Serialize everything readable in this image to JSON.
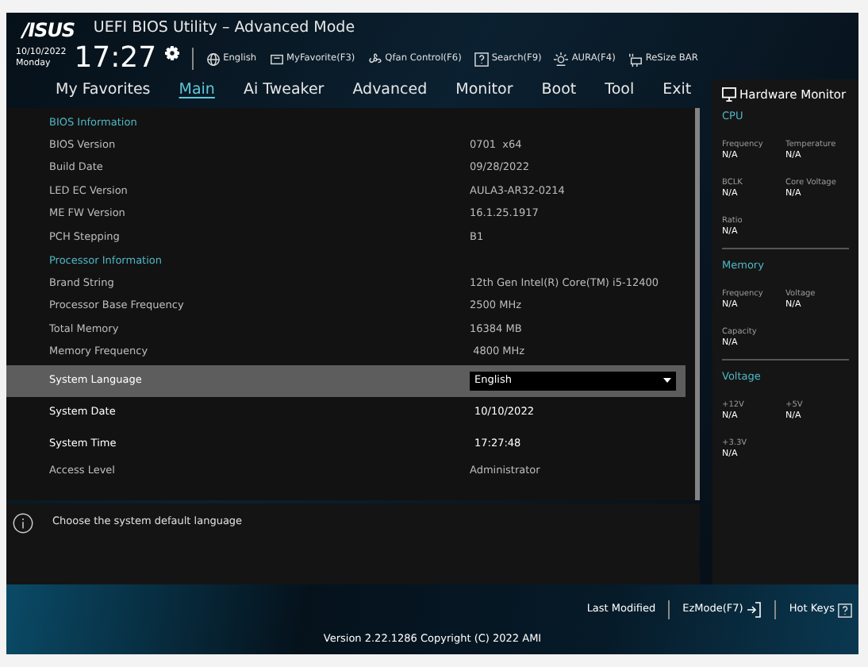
{
  "header": {
    "brand": "/ISUS",
    "title": "UEFI BIOS Utility – Advanced Mode",
    "date": "10/10/2022",
    "day": "Monday",
    "time": "17:27",
    "tools": [
      {
        "kind": "globe",
        "label": "English"
      },
      {
        "kind": "star",
        "label": "MyFavorite(F3)"
      },
      {
        "kind": "fan",
        "label": "Qfan Control(F6)"
      },
      {
        "kind": "help",
        "label": "Search(F9)"
      },
      {
        "kind": "light",
        "label": "AURA(F4)"
      },
      {
        "kind": "bar",
        "label": "ReSize BAR"
      }
    ]
  },
  "tabs": [
    {
      "label": "My Favorites",
      "selected": false
    },
    {
      "label": "Main",
      "selected": true
    },
    {
      "label": "Ai Tweaker",
      "selected": false
    },
    {
      "label": "Advanced",
      "selected": false
    },
    {
      "label": "Monitor",
      "selected": false
    },
    {
      "label": "Boot",
      "selected": false
    },
    {
      "label": "Tool",
      "selected": false
    },
    {
      "label": "Exit",
      "selected": false
    }
  ],
  "rows": [
    {
      "kind": "section",
      "label": "BIOS Information"
    },
    {
      "kind": "info",
      "label": "BIOS Version",
      "value": "0701  x64"
    },
    {
      "kind": "info",
      "label": "Build Date",
      "value": "09/28/2022"
    },
    {
      "kind": "info",
      "label": "LED EC Version",
      "value": "AULA3-AR32-0214"
    },
    {
      "kind": "info",
      "label": "ME FW Version",
      "value": "16.1.25.1917"
    },
    {
      "kind": "info",
      "label": "PCH Stepping",
      "value": "B1"
    },
    {
      "kind": "section",
      "label": "Processor Information"
    },
    {
      "kind": "info",
      "label": "Brand String",
      "value": "12th Gen Intel(R) Core(TM) i5-12400"
    },
    {
      "kind": "info",
      "label": "Processor Base Frequency",
      "value": "2500 MHz"
    },
    {
      "kind": "info",
      "label": "Total Memory",
      "value": "16384 MB"
    },
    {
      "kind": "info",
      "label": "Memory Frequency",
      "value": " 4800 MHz"
    },
    {
      "kind": "dropdown",
      "label": "System Language",
      "value": "English",
      "selected": true
    },
    {
      "kind": "setting",
      "label": "System Date",
      "value": "10/10/2022",
      "selected": false
    },
    {
      "kind": "setting",
      "label": "System Time",
      "value": "17:27:48",
      "selected": false
    },
    {
      "kind": "info",
      "label": "Access Level",
      "value": "Administrator"
    }
  ],
  "help": "Choose the system default language",
  "hardware_monitor": {
    "title": "Hardware Monitor",
    "sections": [
      {
        "title": "CPU",
        "items": [
          {
            "label": "Frequency",
            "value": "N/A"
          },
          {
            "label": "Temperature",
            "value": "N/A"
          },
          {
            "label": "BCLK",
            "value": "N/A"
          },
          {
            "label": "Core Voltage",
            "value": "N/A"
          },
          {
            "label": "Ratio",
            "value": "N/A"
          }
        ]
      },
      {
        "title": "Memory",
        "items": [
          {
            "label": "Frequency",
            "value": "N/A"
          },
          {
            "label": "Voltage",
            "value": "N/A"
          },
          {
            "label": "Capacity",
            "value": "N/A"
          }
        ]
      },
      {
        "title": "Voltage",
        "items": [
          {
            "label": "+12V",
            "value": "N/A"
          },
          {
            "label": "+5V",
            "value": "N/A"
          },
          {
            "label": "+3.3V",
            "value": "N/A"
          }
        ]
      }
    ]
  },
  "footer": {
    "actions": [
      {
        "kind": "text",
        "label": "Last Modified"
      },
      {
        "kind": "exit",
        "label": "EzMode(F7)"
      },
      {
        "kind": "help",
        "label": "Hot Keys"
      }
    ],
    "version": "Version 2.22.1286 Copyright (C) 2022 AMI"
  }
}
